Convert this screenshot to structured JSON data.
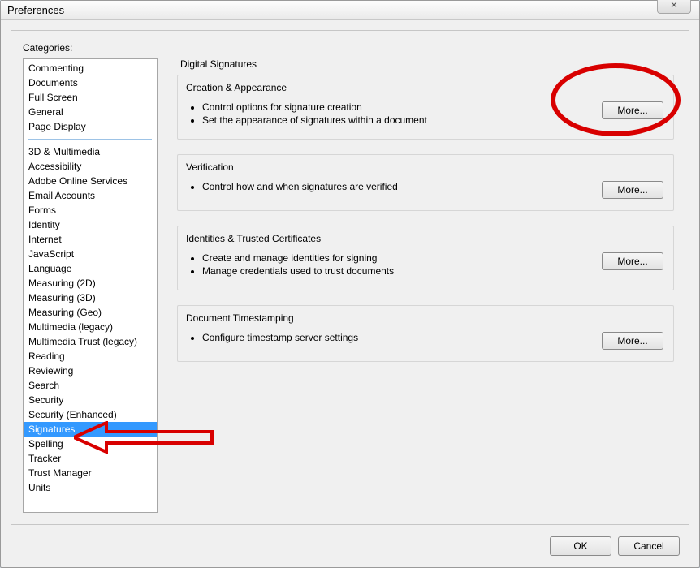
{
  "window": {
    "title": "Preferences",
    "close_label": "✕"
  },
  "categories": {
    "label": "Categories:",
    "group1": [
      "Commenting",
      "Documents",
      "Full Screen",
      "General",
      "Page Display"
    ],
    "group2": [
      "3D & Multimedia",
      "Accessibility",
      "Adobe Online Services",
      "Email Accounts",
      "Forms",
      "Identity",
      "Internet",
      "JavaScript",
      "Language",
      "Measuring (2D)",
      "Measuring (3D)",
      "Measuring (Geo)",
      "Multimedia (legacy)",
      "Multimedia Trust (legacy)",
      "Reading",
      "Reviewing",
      "Search",
      "Security",
      "Security (Enhanced)",
      "Signatures",
      "Spelling",
      "Tracker",
      "Trust Manager",
      "Units"
    ],
    "selected": "Signatures"
  },
  "main": {
    "heading": "Digital Signatures",
    "groups": [
      {
        "title": "Creation & Appearance",
        "bullets": [
          "Control options for signature creation",
          "Set the appearance of signatures within a document"
        ],
        "button": "More..."
      },
      {
        "title": "Verification",
        "bullets": [
          "Control how and when signatures are verified"
        ],
        "button": "More..."
      },
      {
        "title": "Identities & Trusted Certificates",
        "bullets": [
          "Create and manage identities for signing",
          "Manage credentials used to trust documents"
        ],
        "button": "More..."
      },
      {
        "title": "Document Timestamping",
        "bullets": [
          "Configure timestamp server settings"
        ],
        "button": "More..."
      }
    ]
  },
  "footer": {
    "ok": "OK",
    "cancel": "Cancel"
  }
}
